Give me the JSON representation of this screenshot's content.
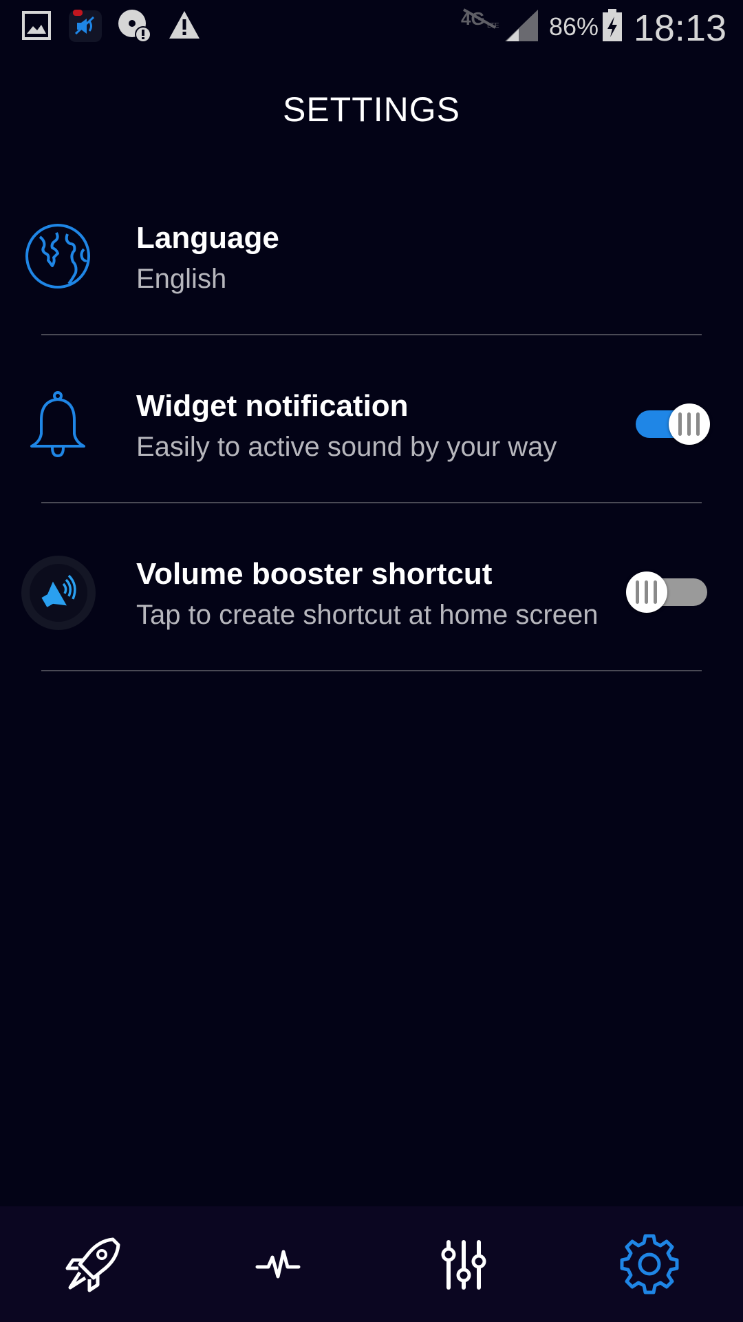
{
  "status_bar": {
    "battery_percent": "86%",
    "time": "18:13",
    "icons": [
      "gallery-icon",
      "app-notification-icon",
      "disc-alert-icon",
      "warning-icon",
      "no-lte-icon",
      "signal-icon",
      "battery-charging-icon"
    ]
  },
  "header": {
    "title": "SETTINGS"
  },
  "settings": [
    {
      "title": "Language",
      "subtitle": "English",
      "icon": "globe-icon"
    },
    {
      "title": "Widget notification",
      "subtitle": "Easily to active sound by your way",
      "icon": "bell-icon",
      "toggle": true
    },
    {
      "title": "Volume booster shortcut",
      "subtitle": "Tap to create shortcut at home screen",
      "icon": "speaker-boost-icon",
      "toggle": false
    }
  ],
  "bottom_nav": {
    "items": [
      "rocket-icon",
      "waveform-icon",
      "equalizer-icon",
      "gear-icon"
    ],
    "active": "gear-icon"
  },
  "colors": {
    "background": "#030316",
    "accent": "#1f86e6",
    "nav_background": "#0b0621",
    "subtitle": "#b7b7bd"
  }
}
